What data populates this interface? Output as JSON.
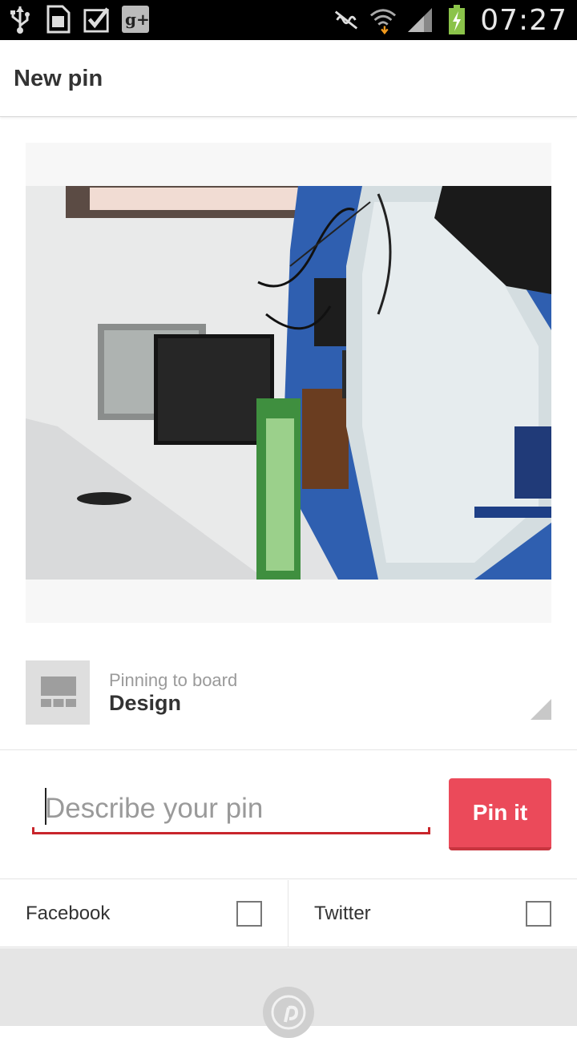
{
  "status_bar": {
    "time": "07:27",
    "icons": [
      "usb-icon",
      "sd-card-icon",
      "checkbox-notification-icon",
      "google-plus-icon",
      "mute-icon",
      "wifi-icon",
      "signal-icon",
      "battery-charging-icon"
    ]
  },
  "app_bar": {
    "title": "New pin"
  },
  "board": {
    "subtitle": "Pinning to board",
    "name": "Design"
  },
  "description": {
    "placeholder": "Describe your pin",
    "value": ""
  },
  "pin_button": {
    "label": "Pin it"
  },
  "share": {
    "facebook_label": "Facebook",
    "twitter_label": "Twitter"
  },
  "colors": {
    "accent": "#eb4a5a",
    "underline": "#c8252b"
  }
}
